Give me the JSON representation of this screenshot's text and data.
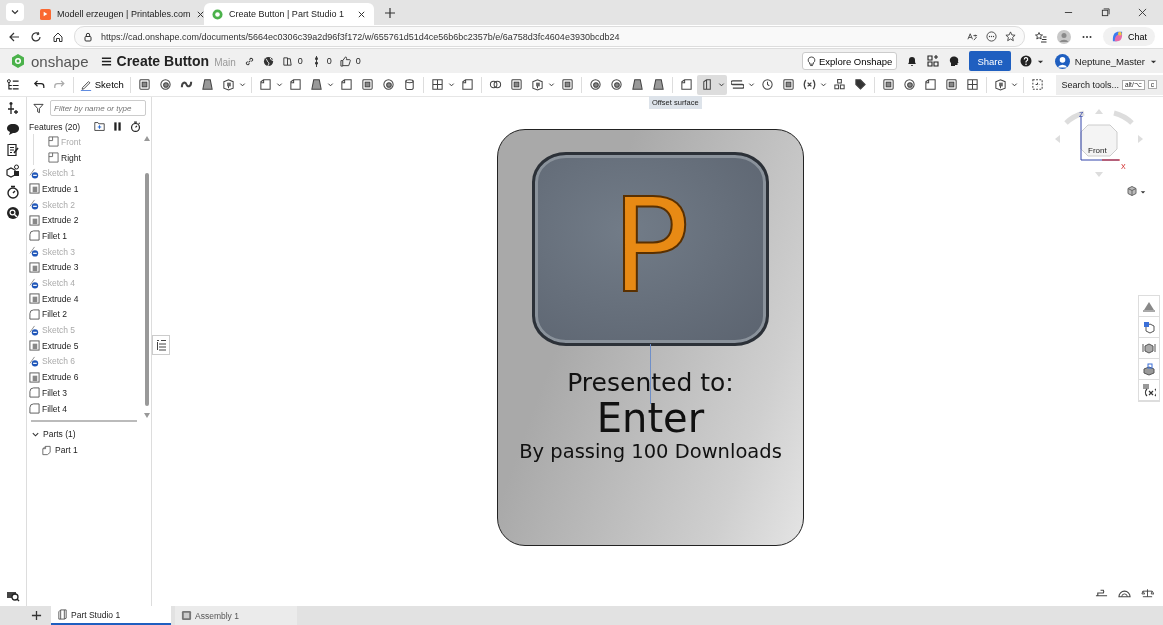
{
  "browser": {
    "tabs": [
      {
        "title": "Modell erzeugen | Printables.com",
        "selected": false,
        "kind": "printables"
      },
      {
        "title": "Create Button | Part Studio 1",
        "selected": true,
        "kind": "onshape"
      }
    ],
    "url": "https://cad.onshape.com/documents/5664ec0306c39a2d96f3f172/w/655761d51d4ce56b6bc2357b/e/6a758d3fc4604e3930bcdb24",
    "chat": "Chat"
  },
  "header": {
    "brand": "onshape",
    "document": "Create Button",
    "branch": "Main",
    "versions": "0",
    "pins": "0",
    "likes": "0",
    "explore": "Explore Onshape",
    "share": "Share",
    "user": "Neptune_Master"
  },
  "toolbar": {
    "sketch": "Sketch",
    "tooltip": "Offset surface",
    "search": "Search tools...",
    "shortcut_keys": [
      "alt/⌥",
      "c"
    ]
  },
  "features": {
    "filter_placeholder": "Filter by name or type",
    "title": "Features (20)",
    "items": [
      {
        "name": "Front",
        "kind": "plane",
        "hidden": true
      },
      {
        "name": "Right",
        "kind": "plane",
        "hidden": false
      },
      {
        "name": "Sketch 1",
        "kind": "sketch",
        "hidden": true
      },
      {
        "name": "Extrude 1",
        "kind": "extrude",
        "hidden": false
      },
      {
        "name": "Sketch 2",
        "kind": "sketch",
        "hidden": true
      },
      {
        "name": "Extrude 2",
        "kind": "extrude",
        "hidden": false
      },
      {
        "name": "Fillet 1",
        "kind": "fillet",
        "hidden": false
      },
      {
        "name": "Sketch 3",
        "kind": "sketch",
        "hidden": true
      },
      {
        "name": "Extrude 3",
        "kind": "extrude",
        "hidden": false
      },
      {
        "name": "Sketch 4",
        "kind": "sketch",
        "hidden": true
      },
      {
        "name": "Extrude 4",
        "kind": "extrude",
        "hidden": false
      },
      {
        "name": "Fillet 2",
        "kind": "fillet",
        "hidden": false
      },
      {
        "name": "Sketch 5",
        "kind": "sketch",
        "hidden": true
      },
      {
        "name": "Extrude 5",
        "kind": "extrude",
        "hidden": false
      },
      {
        "name": "Sketch 6",
        "kind": "sketch",
        "hidden": true
      },
      {
        "name": "Extrude 6",
        "kind": "extrude",
        "hidden": false
      },
      {
        "name": "Fillet 3",
        "kind": "fillet",
        "hidden": false
      },
      {
        "name": "Fillet 4",
        "kind": "fillet",
        "hidden": false
      }
    ],
    "parts": {
      "title": "Parts (1)",
      "expanded": true,
      "children": [
        {
          "name": "Part 1"
        }
      ]
    }
  },
  "model": {
    "letter": "P",
    "lines": [
      "Presented to:",
      "Enter",
      "By passing 100 Downloads"
    ]
  },
  "view_cube": {
    "face": "Front",
    "axis_z": "Z",
    "axis_x": "X"
  },
  "bottom_tabs": [
    {
      "label": "Part Studio 1",
      "selected": true,
      "kind": "partstudio"
    },
    {
      "label": "Assembly 1",
      "selected": false,
      "kind": "assembly"
    }
  ]
}
